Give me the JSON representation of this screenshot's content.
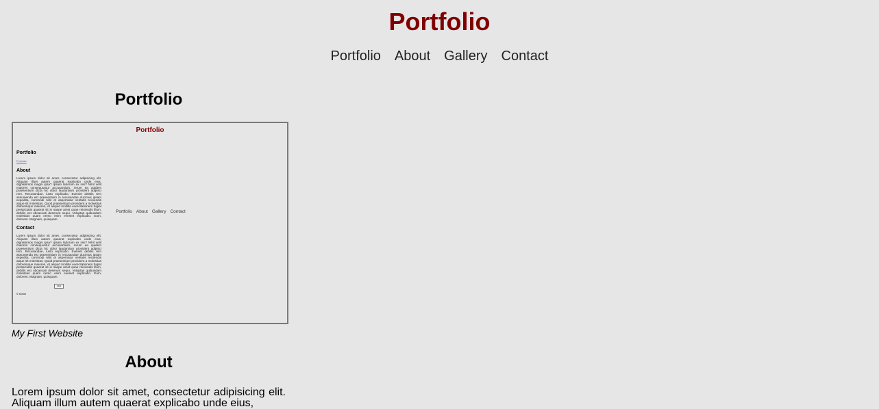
{
  "header": {
    "title": "Portfolio",
    "nav": [
      "Portfolio",
      "About",
      "Gallery",
      "Contact"
    ]
  },
  "portfolio": {
    "heading": "Portfolio",
    "caption": "My First Website",
    "preview": {
      "title": "Portfolio",
      "headings": [
        "Portfolio",
        "About",
        "Contact"
      ],
      "image_alt": "Portfolio",
      "nav": [
        "Portfolio",
        "About",
        "Gallery",
        "Contact"
      ],
      "paragraph": "Lorem ipsum dolor sit amet, consectetur adipisicing elit. Aliquam illum autem quaerat explicabo unde eius, dignissimos magni ipsa? Ipsam laborum ex nisi? Nihil velit maiores consequuntur accusantium, rerum ea quidem praesentium dicta hic dolor laudantium provident adipisci rem. Recusandae, iusto explicabo. Eveniet debitis rem assumenda est praesentium in recusandae ducimus ipsam expedita, commodi nihil et aspernatur veritatis reiciendis atque sit molestias. Quod praesentium provident a molestias doloremque maiores, et aliquid mollitia exercitationem fugiat perspiciatis quaerat sit in saepe amet quae reiciendis illum, debitis est obcaecati deserunt sequi. Voluptas quibusdam molestias quam nemo enim eveniet explicabo. Eum, dolorem. Magnam, quisquam.",
      "button": "Click",
      "footer": "© home"
    }
  },
  "about": {
    "heading": "About",
    "paragraph": "Lorem ipsum dolor sit amet, consectetur adipisicing elit. Aliquam illum autem quaerat explicabo unde eius,"
  }
}
